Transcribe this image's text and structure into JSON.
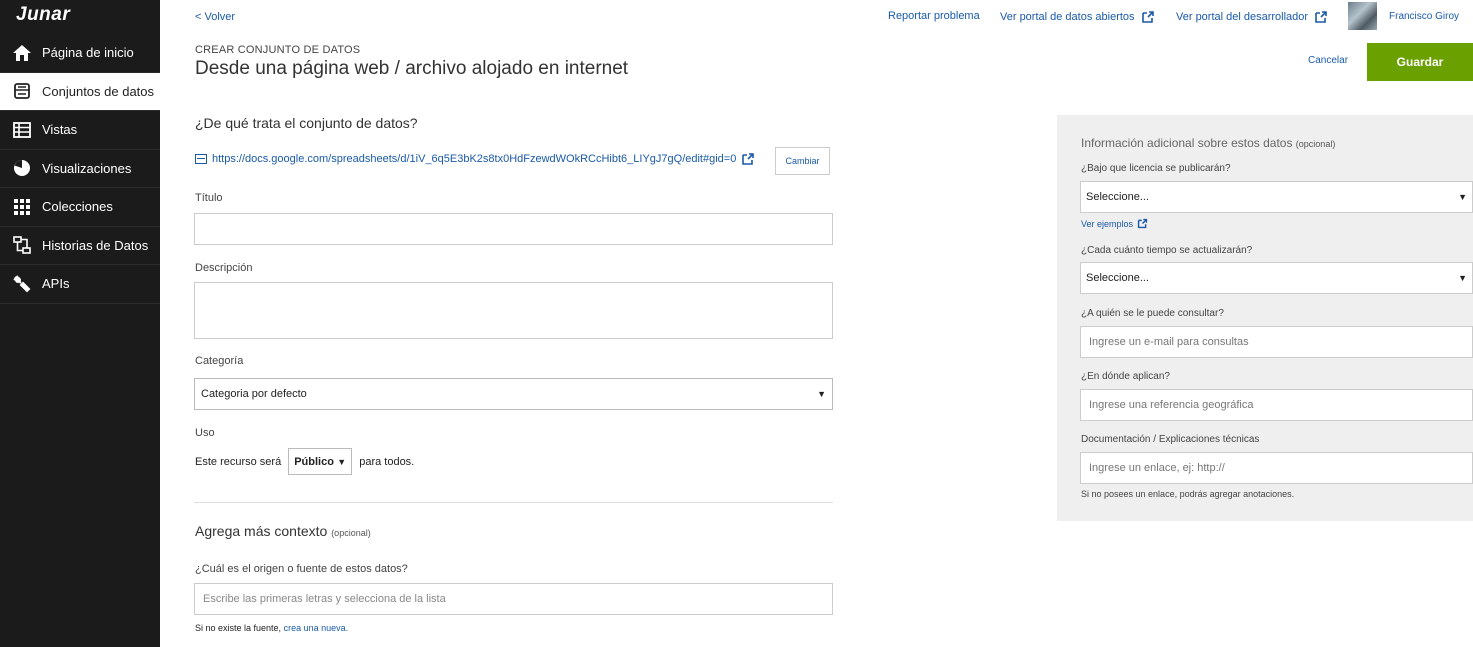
{
  "brand": {
    "logo_text": "Junar"
  },
  "sidebar": {
    "items": [
      {
        "label": "Página de inicio"
      },
      {
        "label": "Conjuntos de datos"
      },
      {
        "label": "Vistas"
      },
      {
        "label": "Visualizaciones"
      },
      {
        "label": "Colecciones"
      },
      {
        "label": "Historias de Datos"
      },
      {
        "label": "APIs"
      }
    ]
  },
  "header": {
    "back_label": "< Volver",
    "report_label": "Reportar problema",
    "open_portal_label": "Ver portal de datos abiertos",
    "dev_portal_label": "Ver portal del desarrollador",
    "user_name": "Francisco Giroy"
  },
  "page": {
    "kicker": "CREAR CONJUNTO DE DATOS",
    "title": "Desde una página web / archivo alojado en internet",
    "cancel_label": "Cancelar",
    "save_label": "Guardar"
  },
  "form": {
    "section_title": "¿De qué trata el conjunto de datos?",
    "url": "https://docs.google.com/spreadsheets/d/1iV_6q5E3bK2s8tx0HdFzewdWOkRCcHibt6_LIYgJ7gQ/edit#gid=0",
    "change_label": "Cambiar",
    "title_label": "Título",
    "title_value": "",
    "description_label": "Descripción",
    "description_value": "",
    "category_label": "Categoría",
    "category_value": "Categoria por defecto",
    "usage_label": "Uso",
    "usage_prefix": "Este recurso será",
    "usage_value": "Público",
    "usage_suffix": "para todos.",
    "context_title": "Agrega más contexto",
    "context_optional": "(opcional)",
    "source_label": "¿Cuál es el origen o fuente de estos datos?",
    "source_placeholder": "Escribe las primeras letras y selecciona de la lista",
    "source_note_prefix": "Si no existe la fuente,",
    "source_note_link": "crea una nueva."
  },
  "side_panel": {
    "title": "Información adicional sobre estos datos",
    "optional": "(opcional)",
    "license_label": "¿Bajo que licencia se publicarán?",
    "license_value": "Seleccione...",
    "examples_link": "Ver ejemplos",
    "frequency_label": "¿Cada cuánto tiempo se actualizarán?",
    "frequency_value": "Seleccione...",
    "contact_label": "¿A quién se le puede consultar?",
    "contact_placeholder": "Ingrese un e-mail para consultas",
    "geo_label": "¿En dónde aplican?",
    "geo_placeholder": "Ingrese una referencia geográfica",
    "docs_label": "Documentación / Explicaciones técnicas",
    "docs_placeholder": "Ingrese un enlace, ej: http://",
    "docs_note": "Si no posees un enlace, podrás agregar anotaciones."
  }
}
